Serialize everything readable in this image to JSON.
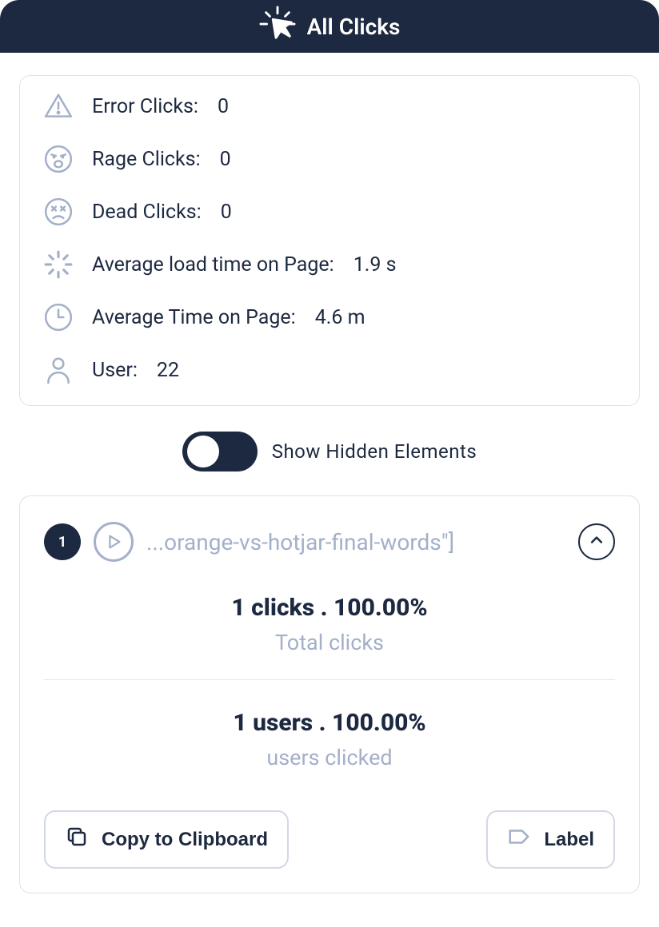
{
  "header": {
    "title": "All Clicks"
  },
  "stats": {
    "error_clicks": {
      "label": "Error Clicks:",
      "value": "0"
    },
    "rage_clicks": {
      "label": "Rage Clicks:",
      "value": "0"
    },
    "dead_clicks": {
      "label": "Dead Clicks:",
      "value": "0"
    },
    "avg_load_time": {
      "label": "Average load time on Page:",
      "value": "1.9 s"
    },
    "avg_time_on_page": {
      "label": "Average Time on Page:",
      "value": "4.6 m"
    },
    "user": {
      "label": "User:",
      "value": "22"
    }
  },
  "toggle": {
    "label": "Show Hidden Elements",
    "state": "off"
  },
  "item": {
    "rank": "1",
    "title": "...orange-vs-hotjar-final-words\"]",
    "clicks_line": "1 clicks . 100.00%",
    "clicks_sub": "Total clicks",
    "users_line": "1 users . 100.00%",
    "users_sub": "users clicked"
  },
  "actions": {
    "copy": "Copy to Clipboard",
    "label": "Label"
  }
}
